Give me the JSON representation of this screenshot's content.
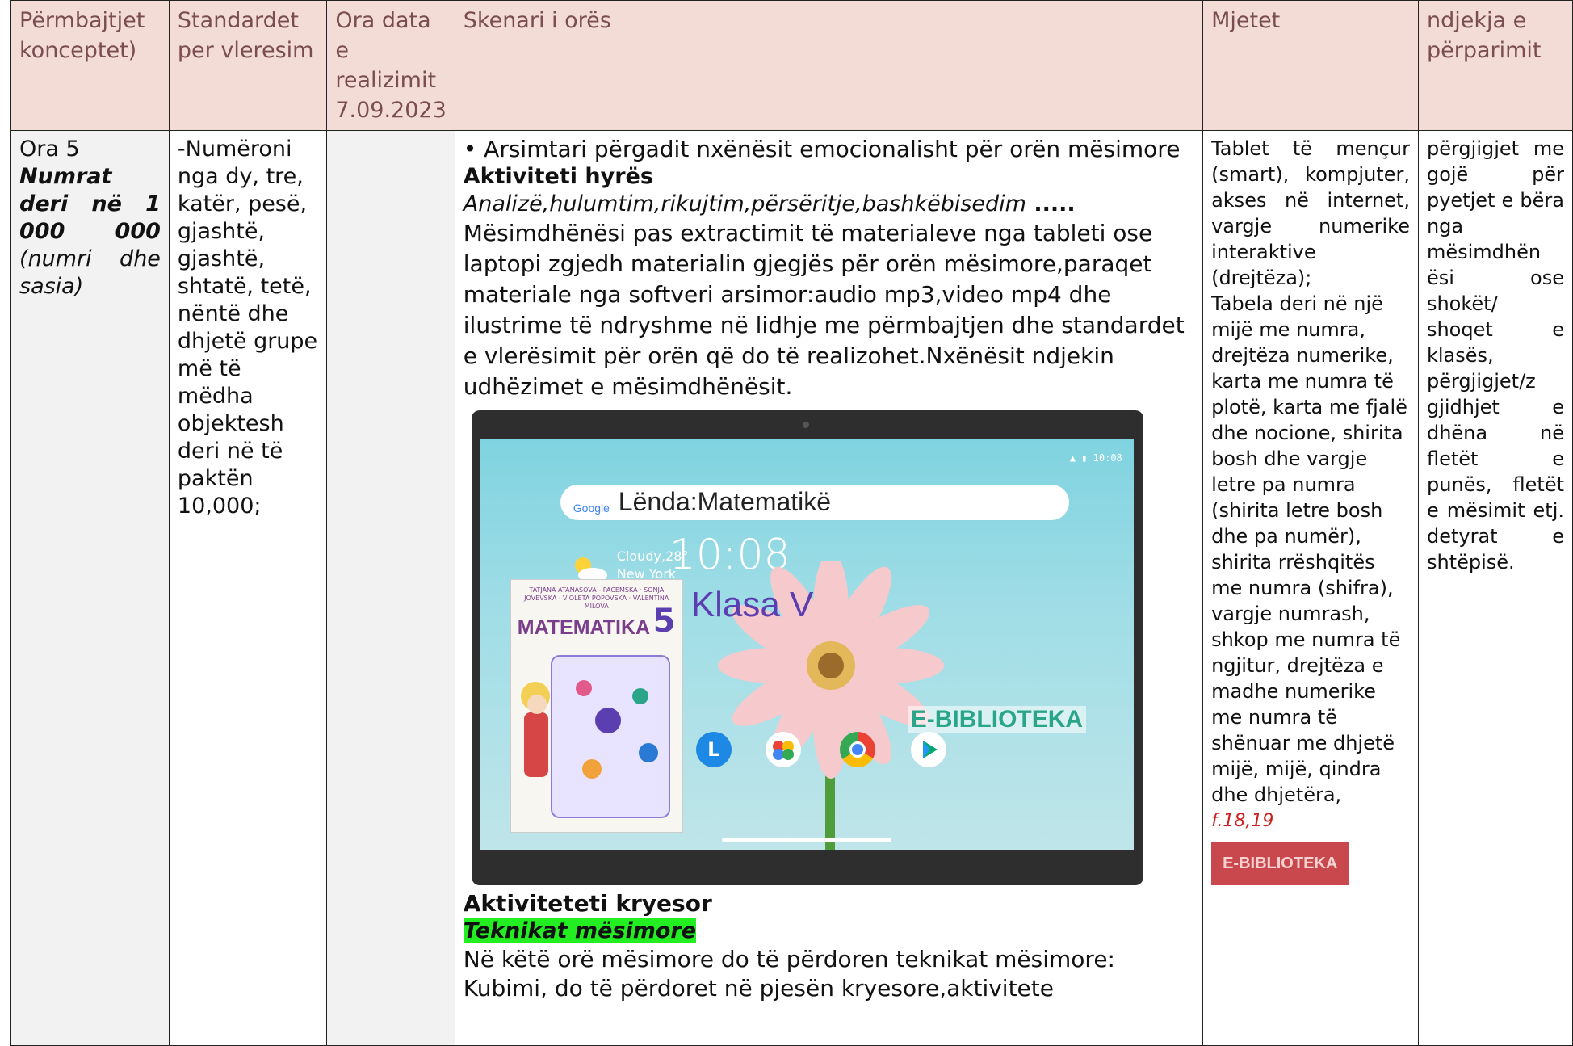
{
  "header": {
    "col1": "Përmbajtjet konceptet)",
    "col2": "Standardet per vleresim",
    "col3": "Ora data e realizimit 7.09.2023",
    "col4": "Skenari i orës",
    "col5": "Mjetet",
    "col6": "ndjekja e përparimit"
  },
  "col1": {
    "ora": "Ora 5",
    "topic": "Numrat deri në 1 000 000",
    "sub": "(numri dhe sasia)"
  },
  "col2": {
    "standard": "-Numëroni nga dy, tre, katër, pesë, gjashtë, gjashtë, shtatë, tetë, nëntë dhe dhjetë grupe më të mëdha objektesh deri në të paktën 10,000;"
  },
  "col4": {
    "intro": "• Arsimtari përgadit nxënësit emocionalisht për orën mësimore",
    "act_title": "Aktiviteti hyrës",
    "methods": "Analizë,hulumtim,rikujtim,përsëritje,bashkëbisedim",
    "dots": " .....",
    "paragraph": "Mësimdhënësi pas extractimit të materialeve nga tableti ose laptopi zgjedh materialin gjegjës për orën mësimore,paraqet materiale nga softveri arsimor:audio mp3,video mp4 dhe ilustrime të ndryshme në lidhje me përmbajtjen dhe standardet e vlerësimit për orën që do të realizohet.Nxënësit ndjekin udhëzimet e mësimdhënësit.",
    "main_title": "Aktiviteteti kryesor",
    "tech_title": "Teknikat mësimore",
    "tech_text": "Në këtë orë mësimore do të përdoren teknikat mësimore: Kubimi, do të përdoret në pjesën kryesore,aktivitete"
  },
  "tablet": {
    "search_logo": "Google",
    "search_text": "Lënda:Matematikë",
    "weather": "Cloudy,28°",
    "city": "New York",
    "time": "10:08",
    "status_time": "10:08",
    "book_authors": "TATJANA ATANASOVA - PACEMSKA · SONJA JOVEVSKA · VIOLETA POPOVSKA · VALENTINA MILOVA",
    "book_title": "MATEMATIKA",
    "book_number": "5",
    "klasa": "Klasa V",
    "library": "E-BIBLIOTEKA",
    "app_l": "L"
  },
  "col5": {
    "p1": "Tablet të mençur (smart), kompjuter, akses në internet, vargje numerike interaktive (drejtëza);",
    "p2": "Tabela deri në një mijë me numra, drejtëza numerike, karta me numra të plotë, karta me fjalë dhe nocione, shirita bosh dhe vargje letre pa numra (shirita letre bosh dhe pa numër), shirita rrëshqitës me numra (shifra), vargje numrash, shkop me numra të ngjitur, drejtëza e madhe numerike me numra të shënuar me dhjetë mijë, mijë, qindra dhe dhjetëra,",
    "ref": "f.18,19",
    "library": "E-BIBLIOTEKA"
  },
  "col6": {
    "text": "përgjigjet me gojë për pyetjet e bëra nga mësimdhën ësi ose shokët/ shoqet e klasës, përgjigjet/z gjidhjet e dhëna në fletët e punës, fletët e mësimit etj. detyrat e shtëpisë."
  },
  "colors": {
    "header_bg": "#f3dcd6",
    "header_text": "#7a4d50",
    "highlight": "#22ee22",
    "ref_red": "#cc1f1f",
    "library_red": "#c9484e"
  }
}
